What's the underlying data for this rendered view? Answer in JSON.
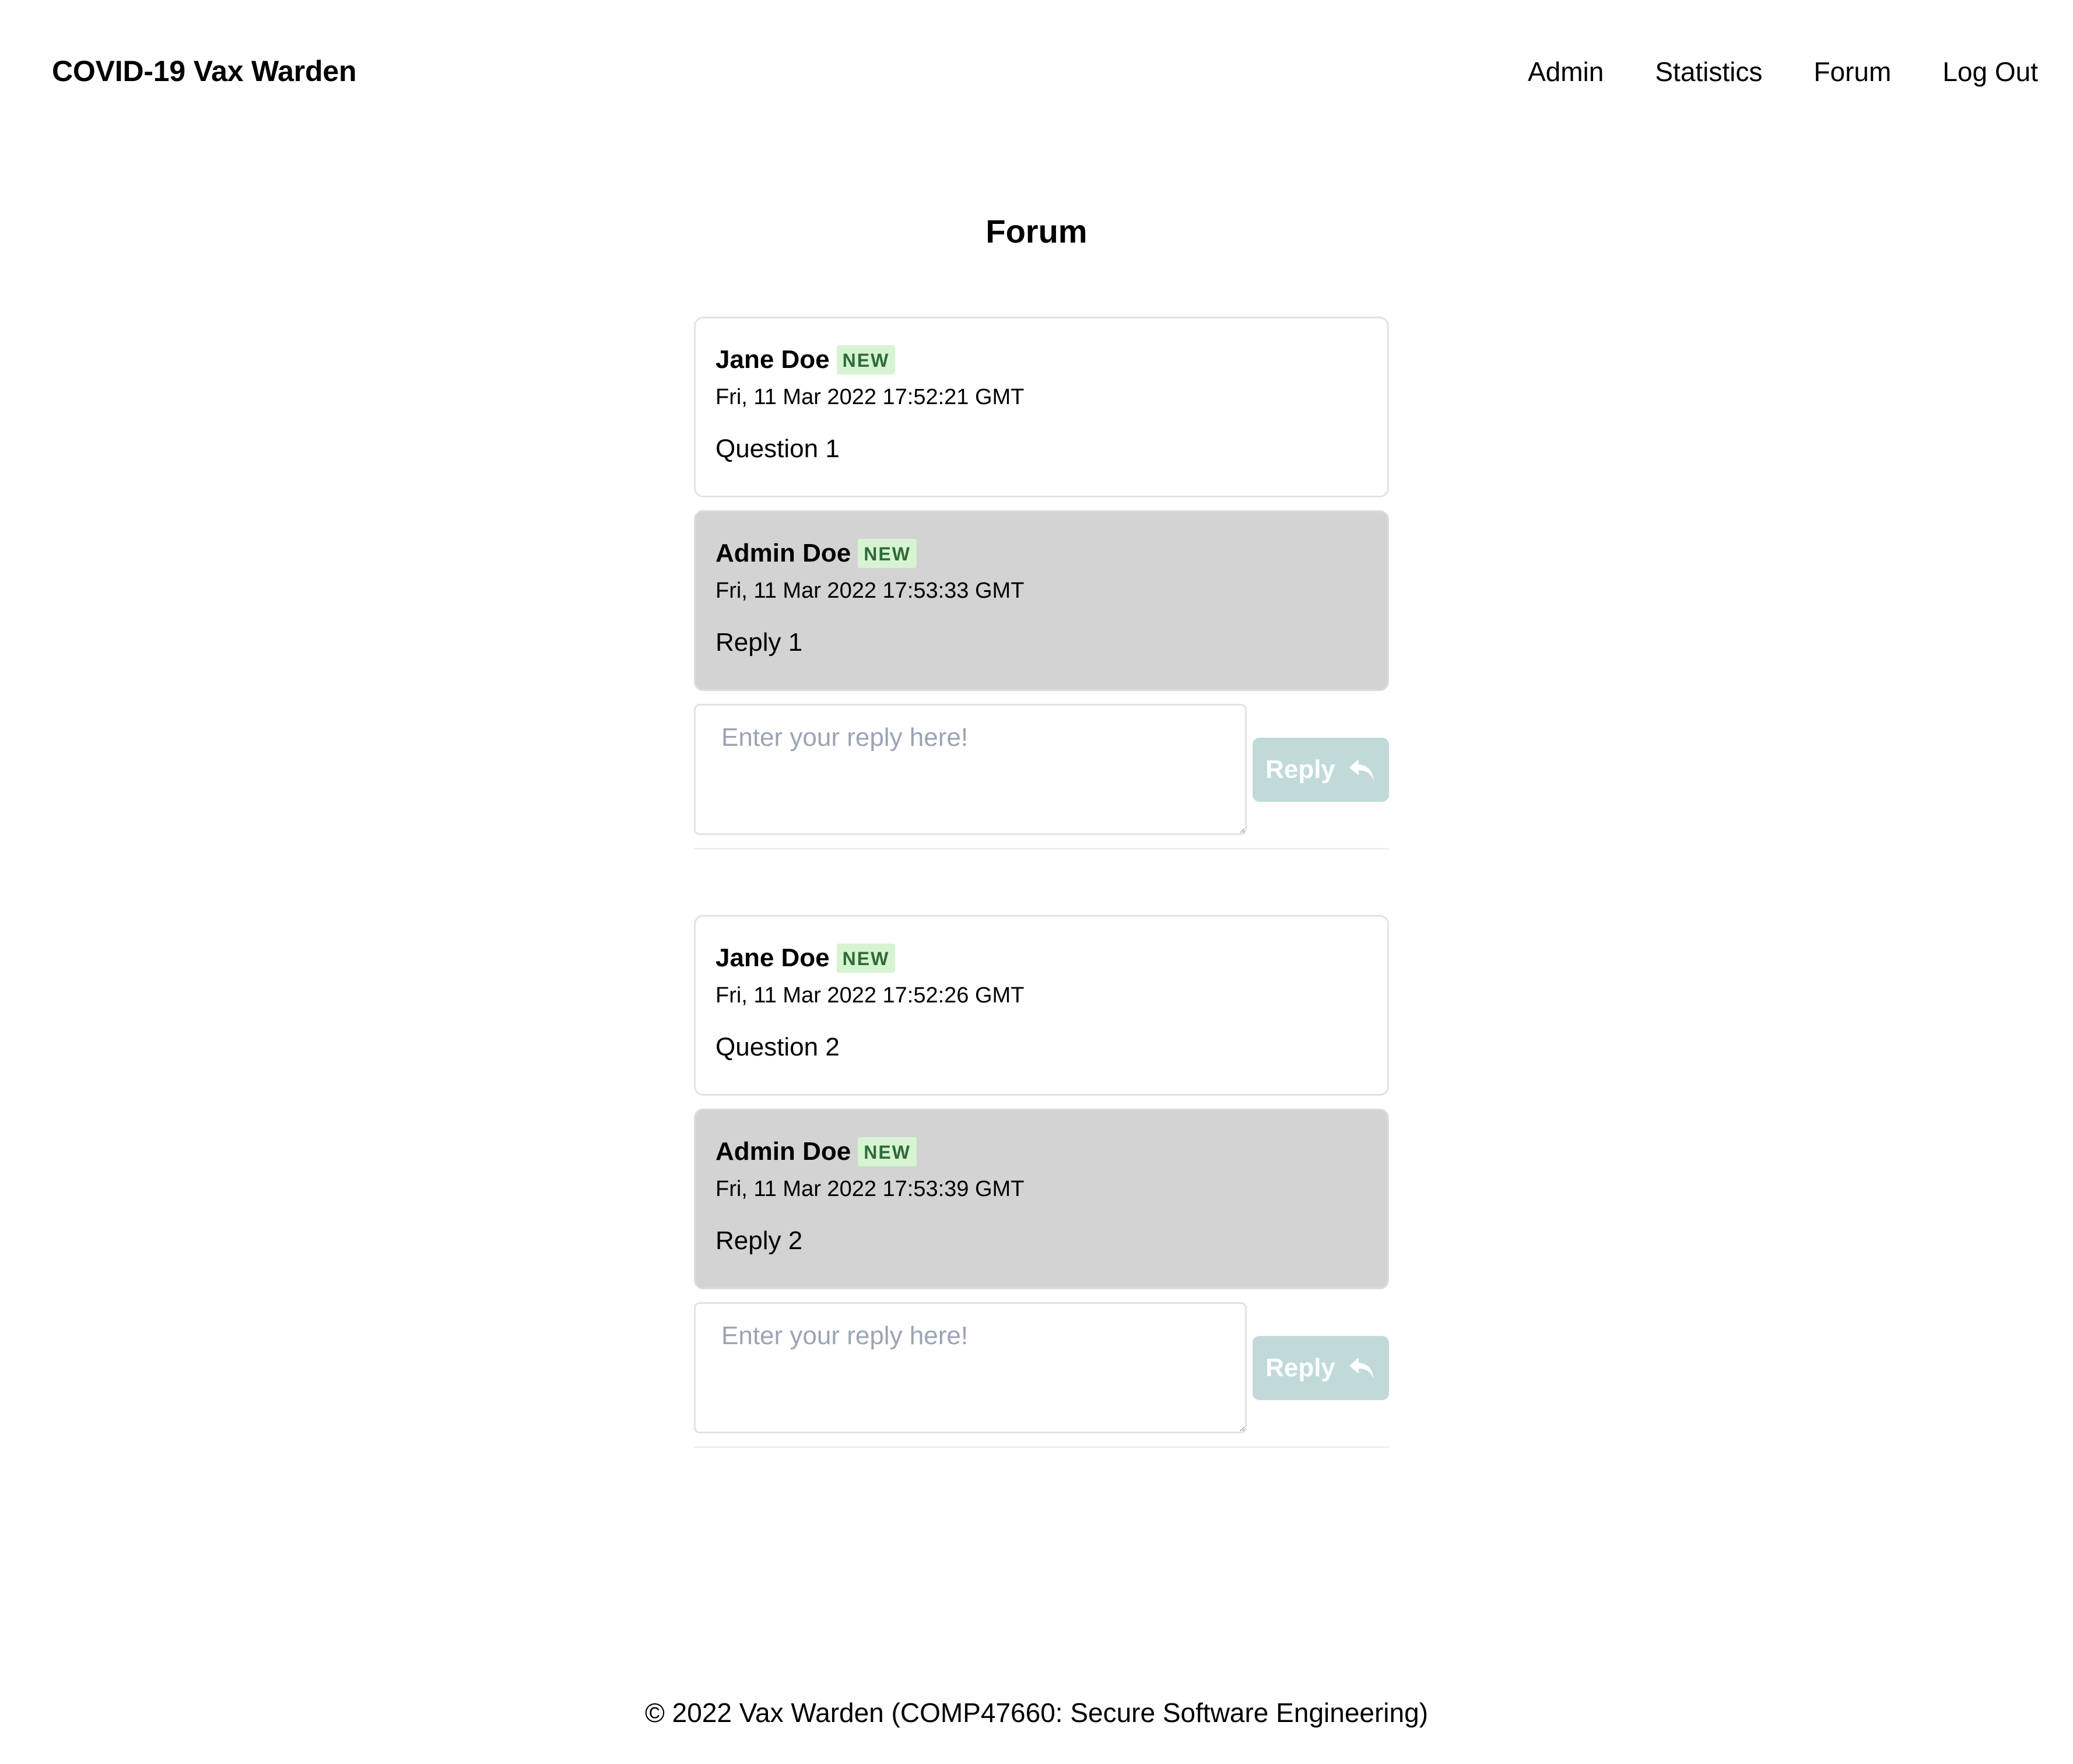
{
  "header": {
    "brand": "COVID-19 Vax Warden",
    "nav": [
      "Admin",
      "Statistics",
      "Forum",
      "Log Out"
    ]
  },
  "page_title": "Forum",
  "threads": [
    {
      "question": {
        "author": "Jane Doe",
        "badge": "NEW",
        "date": "Fri, 11 Mar 2022 17:52:21 GMT",
        "text": "Question 1"
      },
      "reply": {
        "author": "Admin Doe",
        "badge": "NEW",
        "date": "Fri, 11 Mar 2022 17:53:33 GMT",
        "text": "Reply 1"
      },
      "reply_placeholder": "Enter your reply here!",
      "reply_button": "Reply"
    },
    {
      "question": {
        "author": "Jane Doe",
        "badge": "NEW",
        "date": "Fri, 11 Mar 2022 17:52:26 GMT",
        "text": "Question 2"
      },
      "reply": {
        "author": "Admin Doe",
        "badge": "NEW",
        "date": "Fri, 11 Mar 2022 17:53:39 GMT",
        "text": "Reply 2"
      },
      "reply_placeholder": "Enter your reply here!",
      "reply_button": "Reply"
    }
  ],
  "footer": "© 2022 Vax Warden (COMP47660: Secure Software Engineering)",
  "icons": {
    "reply_button_icon": "reply-arrow-icon"
  },
  "colors": {
    "new_badge_bg": "#d6f4d1",
    "new_badge_text": "#2f6b36",
    "reply_card_bg": "#d3d3d3",
    "reply_button_bg": "#c1dad9"
  }
}
